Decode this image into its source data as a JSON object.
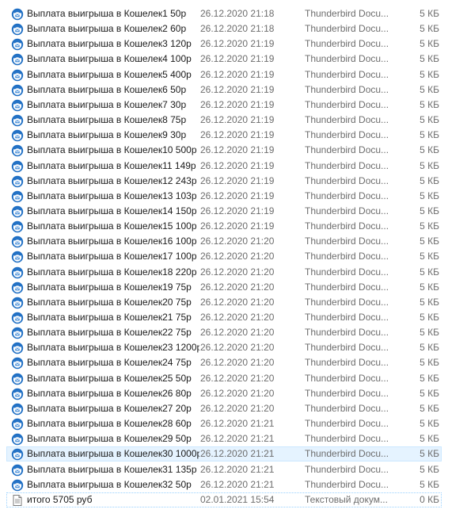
{
  "files": [
    {
      "name": "Выплата выигрыша в Кошелек1 50р",
      "date": "26.12.2020 21:18",
      "type": "Thunderbird Docu...",
      "size": "5 КБ",
      "icon": "thunderbird-doc-icon"
    },
    {
      "name": "Выплата выигрыша в Кошелек2 60р",
      "date": "26.12.2020 21:18",
      "type": "Thunderbird Docu...",
      "size": "5 КБ",
      "icon": "thunderbird-doc-icon"
    },
    {
      "name": "Выплата выигрыша в Кошелек3 120р",
      "date": "26.12.2020 21:19",
      "type": "Thunderbird Docu...",
      "size": "5 КБ",
      "icon": "thunderbird-doc-icon"
    },
    {
      "name": "Выплата выигрыша в Кошелек4 100р",
      "date": "26.12.2020 21:19",
      "type": "Thunderbird Docu...",
      "size": "5 КБ",
      "icon": "thunderbird-doc-icon"
    },
    {
      "name": "Выплата выигрыша в Кошелек5 400р",
      "date": "26.12.2020 21:19",
      "type": "Thunderbird Docu...",
      "size": "5 КБ",
      "icon": "thunderbird-doc-icon"
    },
    {
      "name": "Выплата выигрыша в Кошелек6 50р",
      "date": "26.12.2020 21:19",
      "type": "Thunderbird Docu...",
      "size": "5 КБ",
      "icon": "thunderbird-doc-icon"
    },
    {
      "name": "Выплата выигрыша в Кошелек7 30р",
      "date": "26.12.2020 21:19",
      "type": "Thunderbird Docu...",
      "size": "5 КБ",
      "icon": "thunderbird-doc-icon"
    },
    {
      "name": "Выплата выигрыша в Кошелек8 75р",
      "date": "26.12.2020 21:19",
      "type": "Thunderbird Docu...",
      "size": "5 КБ",
      "icon": "thunderbird-doc-icon"
    },
    {
      "name": "Выплата выигрыша в Кошелек9 30р",
      "date": "26.12.2020 21:19",
      "type": "Thunderbird Docu...",
      "size": "5 КБ",
      "icon": "thunderbird-doc-icon"
    },
    {
      "name": "Выплата выигрыша в Кошелек10 500р",
      "date": "26.12.2020 21:19",
      "type": "Thunderbird Docu...",
      "size": "5 КБ",
      "icon": "thunderbird-doc-icon"
    },
    {
      "name": "Выплата выигрыша в Кошелек11 149р",
      "date": "26.12.2020 21:19",
      "type": "Thunderbird Docu...",
      "size": "5 КБ",
      "icon": "thunderbird-doc-icon"
    },
    {
      "name": "Выплата выигрыша в Кошелек12 243р",
      "date": "26.12.2020 21:19",
      "type": "Thunderbird Docu...",
      "size": "5 КБ",
      "icon": "thunderbird-doc-icon"
    },
    {
      "name": "Выплата выигрыша в Кошелек13 103р",
      "date": "26.12.2020 21:19",
      "type": "Thunderbird Docu...",
      "size": "5 КБ",
      "icon": "thunderbird-doc-icon"
    },
    {
      "name": "Выплата выигрыша в Кошелек14 150р",
      "date": "26.12.2020 21:19",
      "type": "Thunderbird Docu...",
      "size": "5 КБ",
      "icon": "thunderbird-doc-icon"
    },
    {
      "name": "Выплата выигрыша в Кошелек15 100р",
      "date": "26.12.2020 21:19",
      "type": "Thunderbird Docu...",
      "size": "5 КБ",
      "icon": "thunderbird-doc-icon"
    },
    {
      "name": "Выплата выигрыша в Кошелек16 100р",
      "date": "26.12.2020 21:20",
      "type": "Thunderbird Docu...",
      "size": "5 КБ",
      "icon": "thunderbird-doc-icon"
    },
    {
      "name": "Выплата выигрыша в Кошелек17 100р",
      "date": "26.12.2020 21:20",
      "type": "Thunderbird Docu...",
      "size": "5 КБ",
      "icon": "thunderbird-doc-icon"
    },
    {
      "name": "Выплата выигрыша в Кошелек18 220р",
      "date": "26.12.2020 21:20",
      "type": "Thunderbird Docu...",
      "size": "5 КБ",
      "icon": "thunderbird-doc-icon"
    },
    {
      "name": "Выплата выигрыша в Кошелек19 75р",
      "date": "26.12.2020 21:20",
      "type": "Thunderbird Docu...",
      "size": "5 КБ",
      "icon": "thunderbird-doc-icon"
    },
    {
      "name": "Выплата выигрыша в Кошелек20 75р",
      "date": "26.12.2020 21:20",
      "type": "Thunderbird Docu...",
      "size": "5 КБ",
      "icon": "thunderbird-doc-icon"
    },
    {
      "name": "Выплата выигрыша в Кошелек21 75р",
      "date": "26.12.2020 21:20",
      "type": "Thunderbird Docu...",
      "size": "5 КБ",
      "icon": "thunderbird-doc-icon"
    },
    {
      "name": "Выплата выигрыша в Кошелек22 75р",
      "date": "26.12.2020 21:20",
      "type": "Thunderbird Docu...",
      "size": "5 КБ",
      "icon": "thunderbird-doc-icon"
    },
    {
      "name": "Выплата выигрыша в Кошелек23 1200р",
      "date": "26.12.2020 21:20",
      "type": "Thunderbird Docu...",
      "size": "5 КБ",
      "icon": "thunderbird-doc-icon"
    },
    {
      "name": "Выплата выигрыша в Кошелек24 75р",
      "date": "26.12.2020 21:20",
      "type": "Thunderbird Docu...",
      "size": "5 КБ",
      "icon": "thunderbird-doc-icon"
    },
    {
      "name": "Выплата выигрыша в Кошелек25 50р",
      "date": "26.12.2020 21:20",
      "type": "Thunderbird Docu...",
      "size": "5 КБ",
      "icon": "thunderbird-doc-icon"
    },
    {
      "name": "Выплата выигрыша в Кошелек26 80р",
      "date": "26.12.2020 21:20",
      "type": "Thunderbird Docu...",
      "size": "5 КБ",
      "icon": "thunderbird-doc-icon"
    },
    {
      "name": "Выплата выигрыша в Кошелек27 20р",
      "date": "26.12.2020 21:20",
      "type": "Thunderbird Docu...",
      "size": "5 КБ",
      "icon": "thunderbird-doc-icon"
    },
    {
      "name": "Выплата выигрыша в Кошелек28 60р",
      "date": "26.12.2020 21:21",
      "type": "Thunderbird Docu...",
      "size": "5 КБ",
      "icon": "thunderbird-doc-icon"
    },
    {
      "name": "Выплата выигрыша в Кошелек29 50р",
      "date": "26.12.2020 21:21",
      "type": "Thunderbird Docu...",
      "size": "5 КБ",
      "icon": "thunderbird-doc-icon"
    },
    {
      "name": "Выплата выигрыша в Кошелек30 1000р",
      "date": "26.12.2020 21:21",
      "type": "Thunderbird Docu...",
      "size": "5 КБ",
      "icon": "thunderbird-doc-icon",
      "selected": true
    },
    {
      "name": "Выплата выигрыша в Кошелек31 135р",
      "date": "26.12.2020 21:21",
      "type": "Thunderbird Docu...",
      "size": "5 КБ",
      "icon": "thunderbird-doc-icon"
    },
    {
      "name": "Выплата выигрыша в Кошелек32 50р",
      "date": "26.12.2020 21:21",
      "type": "Thunderbird Docu...",
      "size": "5 КБ",
      "icon": "thunderbird-doc-icon"
    },
    {
      "name": "итого 5705 руб",
      "date": "02.01.2021 15:54",
      "type": "Текстовый докум...",
      "size": "0 КБ",
      "icon": "text-document-icon",
      "focused": true
    }
  ]
}
